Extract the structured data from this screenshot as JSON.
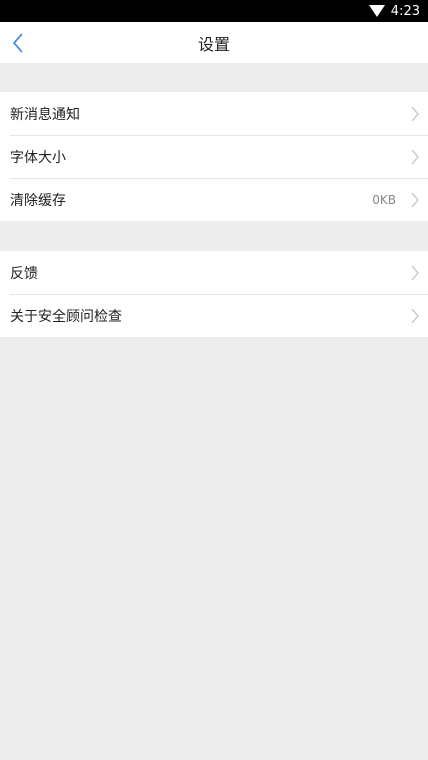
{
  "status_bar": {
    "time": "4:23"
  },
  "nav": {
    "title": "设置"
  },
  "group1": {
    "items": [
      {
        "label": "新消息通知"
      },
      {
        "label": "字体大小"
      },
      {
        "label": "清除缓存",
        "value": "0KB"
      }
    ]
  },
  "group2": {
    "items": [
      {
        "label": "反馈"
      },
      {
        "label": "关于安全顾问检查"
      }
    ]
  },
  "colors": {
    "accent": "#4a90e2",
    "background": "#ededed",
    "status_bar": "#000000"
  }
}
